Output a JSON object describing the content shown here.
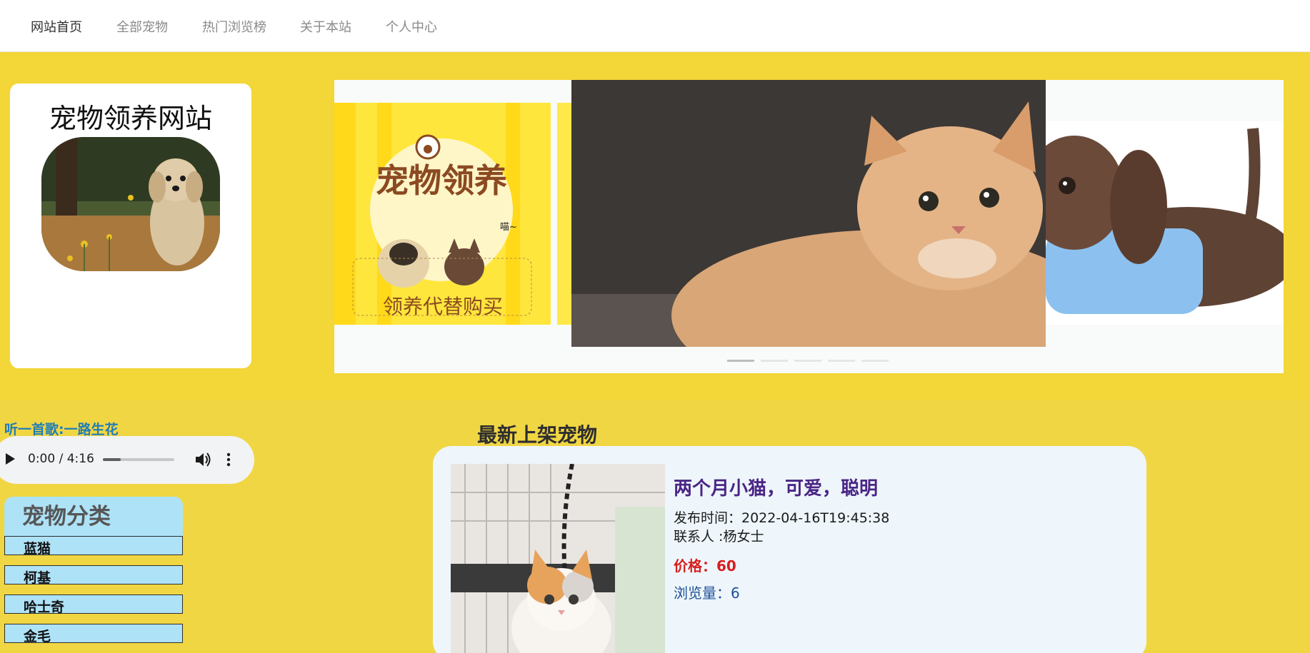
{
  "nav": {
    "items": [
      {
        "label": "网站首页"
      },
      {
        "label": "全部宠物"
      },
      {
        "label": "热门浏览榜"
      },
      {
        "label": "关于本站"
      },
      {
        "label": "个人中心"
      }
    ]
  },
  "site": {
    "title": "宠物领养网站"
  },
  "carousel": {
    "slides": [
      {
        "text_line1": "宠物领养",
        "text_line2": "领养代替购买",
        "meow": "喵~"
      }
    ]
  },
  "music": {
    "label": "听一首歌:一路生花",
    "time": "0:00 / 4:16",
    "progress_fraction": 0.25
  },
  "categories": {
    "title": "宠物分类",
    "items": [
      {
        "label": "蓝猫"
      },
      {
        "label": "柯基"
      },
      {
        "label": "哈士奇"
      },
      {
        "label": "金毛"
      }
    ]
  },
  "latest": {
    "title": "最新上架宠物",
    "pet": {
      "title": "两个月小猫，可爱，聪明",
      "published": "发布时间：2022-04-16T19:45:38",
      "contact": "联系人 :杨女士",
      "price": "价格：60",
      "views": "浏览量：6"
    }
  },
  "colors": {
    "background": "#f3d637",
    "category_bg": "#aee2f7",
    "pet_title": "#4b2586",
    "price": "#d71e1e",
    "views": "#1d4f97",
    "music_label": "#1f7db8"
  }
}
